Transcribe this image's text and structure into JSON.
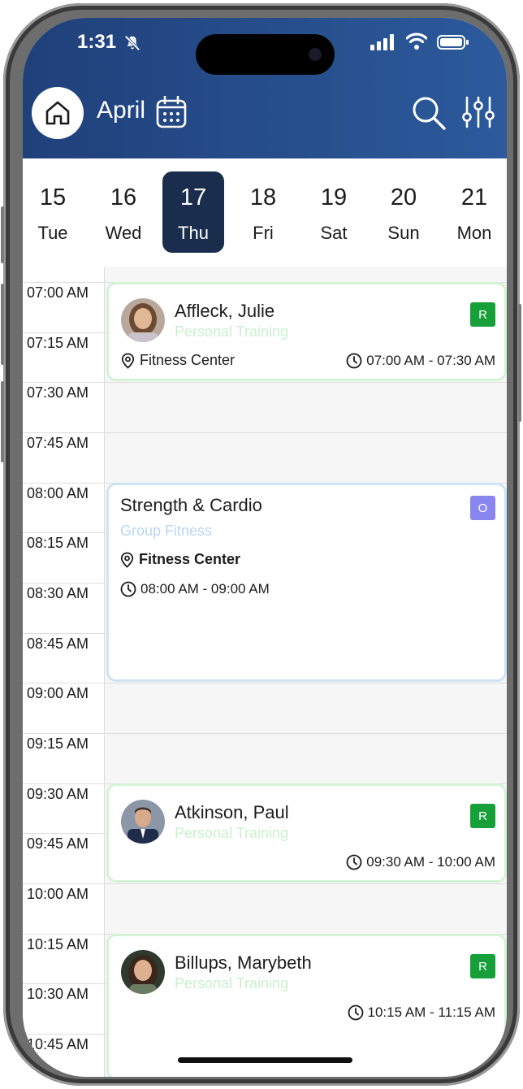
{
  "status": {
    "time": "1:31"
  },
  "header": {
    "month": "April"
  },
  "days": [
    {
      "num": "15",
      "dow": "Tue"
    },
    {
      "num": "16",
      "dow": "Wed"
    },
    {
      "num": "17",
      "dow": "Thu"
    },
    {
      "num": "18",
      "dow": "Fri"
    },
    {
      "num": "19",
      "dow": "Sat"
    },
    {
      "num": "20",
      "dow": "Sun"
    },
    {
      "num": "21",
      "dow": "Mon"
    }
  ],
  "selected_day": "17",
  "time_slots": [
    "07:00 AM",
    "07:15 AM",
    "07:30 AM",
    "07:45 AM",
    "08:00 AM",
    "08:15 AM",
    "08:30 AM",
    "08:45 AM",
    "09:00 AM",
    "09:15 AM",
    "09:30 AM",
    "09:45 AM",
    "10:00 AM",
    "10:15 AM",
    "10:30 AM",
    "10:45 AM"
  ],
  "events": [
    {
      "name": "Affleck, Julie",
      "type": "Personal Training",
      "location": "Fitness Center",
      "time": "07:00 AM - 07:30 AM",
      "tag": "R"
    },
    {
      "name": "Strength & Cardio",
      "type": "Group Fitness",
      "location": "Fitness Center",
      "time": "08:00 AM - 09:00 AM",
      "tag": "O"
    },
    {
      "name": "Atkinson, Paul",
      "type": "Personal Training",
      "time": "09:30 AM - 10:00 AM",
      "tag": "R"
    },
    {
      "name": "Billups, Marybeth",
      "type": "Personal Training",
      "time": "10:15 AM - 11:15 AM",
      "tag": "R"
    }
  ],
  "colors": {
    "header": "#2c5a9c",
    "selected_day": "#1a2d4d",
    "tag_green": "#17a03a",
    "tag_purple": "#8a86ef"
  }
}
